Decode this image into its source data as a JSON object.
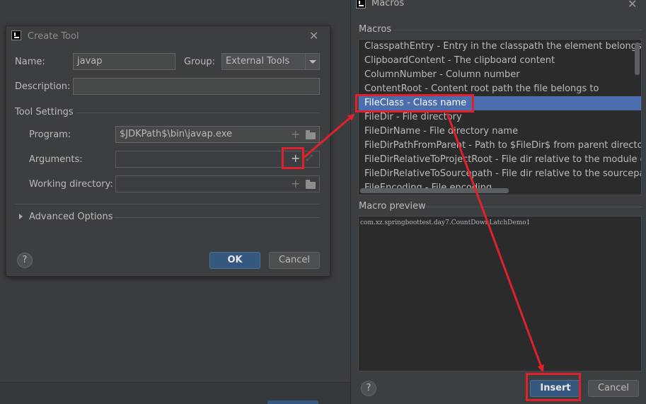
{
  "create_tool": {
    "title": "Create Tool",
    "name_label": "Name:",
    "name_value": "javap",
    "group_label": "Group:",
    "group_value": "External Tools",
    "description_label": "Description:",
    "description_value": "",
    "tool_settings_label": "Tool Settings",
    "program_label": "Program:",
    "program_value": "$JDKPath$\\bin\\javap.exe",
    "arguments_label": "Arguments:",
    "arguments_value": "",
    "working_dir_label": "Working directory:",
    "working_dir_value": "",
    "advanced_label": "Advanced Options",
    "help_label": "?",
    "ok_label": "OK",
    "cancel_label": "Cancel"
  },
  "macros": {
    "title": "Macros",
    "section_label": "Macros",
    "items": [
      "ClasspathEntry - Entry in the classpath the element belongs to",
      "ClipboardContent - The clipboard content",
      "ColumnNumber - Column number",
      "ContentRoot - Content root path the file belongs to",
      "FileClass - Class name",
      "FileDir - File directory",
      "FileDirName - File directory name",
      "FileDirPathFromParent - Path to $FileDir$ from parent directory with",
      "FileDirRelativeToProjectRoot - File dir relative to the module conten",
      "FileDirRelativeToSourcepath - File dir relative to the sourcepath roo",
      "FileEncoding - File encoding"
    ],
    "selected_index": 4,
    "preview_label": "Macro preview",
    "preview_value": "com.xz.springboottest.day7.CountDownLatchDemo1",
    "help_label": "?",
    "insert_label": "Insert",
    "cancel_label": "Cancel"
  },
  "icons": {
    "app": "intellij-icon",
    "close": "close-icon",
    "add": "plus-icon",
    "folder": "folder-icon",
    "expand": "expand-icon",
    "dropdown": "chevron-down-icon",
    "disclosure": "triangle-right-icon"
  },
  "colors": {
    "selection": "#4b6eaf",
    "primary_button": "#365880",
    "annotation": "#e0212a"
  }
}
